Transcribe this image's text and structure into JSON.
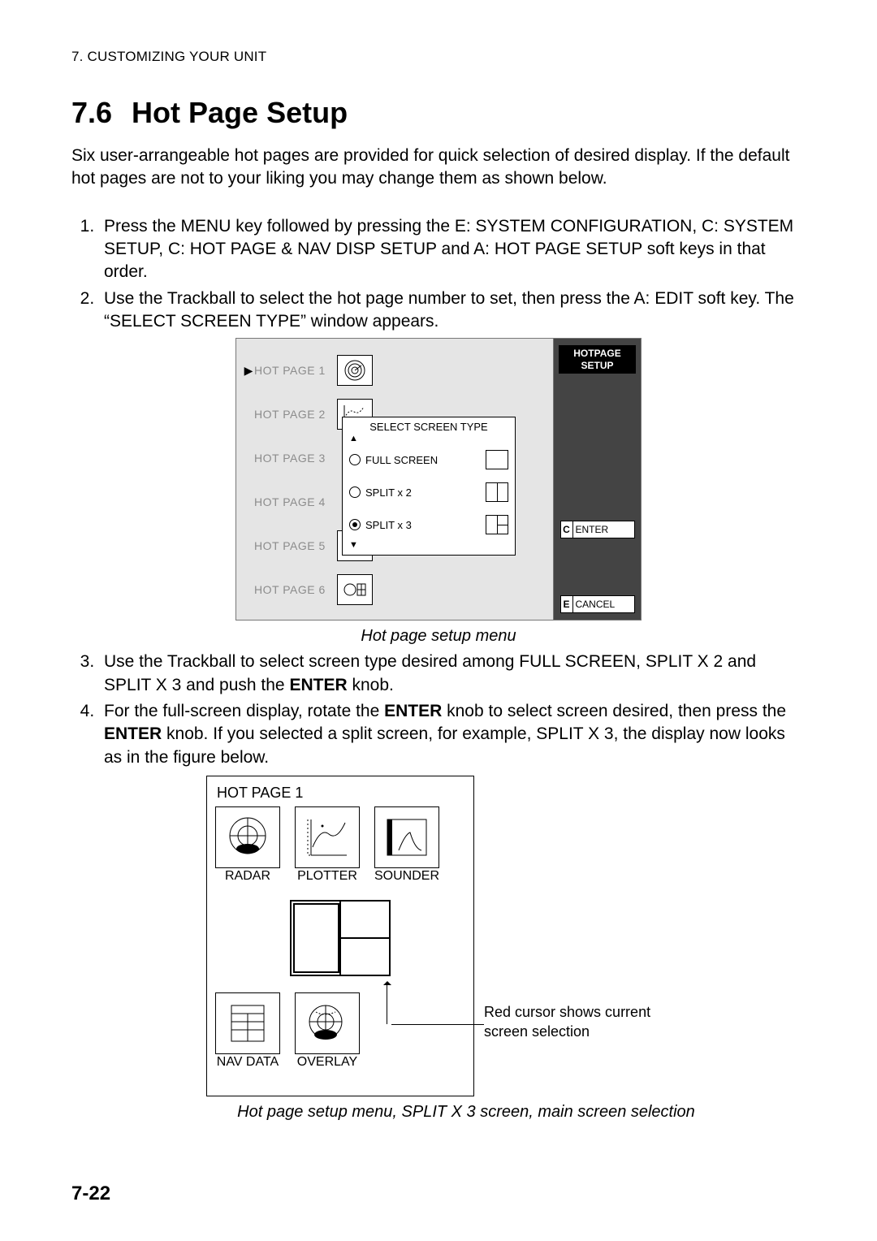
{
  "header": {
    "running": "7. CUSTOMIZING YOUR UNIT"
  },
  "section": {
    "number": "7.6",
    "title": "Hot Page Setup"
  },
  "intro": "Six user-arrangeable hot pages are provided for quick selection of desired display. If the default hot pages are not to your liking you may change them as shown below.",
  "steps": {
    "s1": "Press the MENU key followed by pressing the E: SYSTEM CONFIGURATION, C: SYSTEM SETUP, C: HOT PAGE & NAV DISP SETUP and A: HOT PAGE SETUP soft keys in that order.",
    "s2": "Use the Trackball to select the hot page number to set, then press the A: EDIT soft key. The “SELECT SCREEN TYPE” window appears.",
    "s3_a": "Use the Trackball to select screen type desired among FULL SCREEN, SPLIT X 2 and SPLIT X 3 and push the ",
    "s3_b": "ENTER",
    "s3_c": " knob.",
    "s4_a": "For the full-screen display, rotate the ",
    "s4_b": "ENTER",
    "s4_c": " knob to select screen desired, then press the ",
    "s4_d": "ENTER",
    "s4_e": " knob. If you selected a split screen, for example, SPLIT X 3, the display now looks as in the figure below."
  },
  "fig1": {
    "soft_title_l1": "HOTPAGE",
    "soft_title_l2": "SETUP",
    "enter_key": {
      "k": "C",
      "t": "ENTER"
    },
    "cancel_key": {
      "k": "E",
      "t": "CANCEL"
    },
    "pages": [
      "HOT PAGE 1",
      "HOT PAGE 2",
      "HOT PAGE 3",
      "HOT PAGE 4",
      "HOT PAGE 5",
      "HOT PAGE 6"
    ],
    "popup_title": "SELECT SCREEN TYPE",
    "opts": [
      "FULL SCREEN",
      "SPLIT x 2",
      "SPLIT x 3"
    ],
    "caption": "Hot page setup menu"
  },
  "fig2": {
    "title": "HOT PAGE 1",
    "cells": [
      "RADAR",
      "PLOTTER",
      "SOUNDER",
      "NAV DATA",
      "OVERLAY"
    ],
    "annot": "Red cursor shows current screen selection",
    "caption": "Hot page setup menu, SPLIT X 3 screen, main screen selection"
  },
  "page_number": "7-22"
}
